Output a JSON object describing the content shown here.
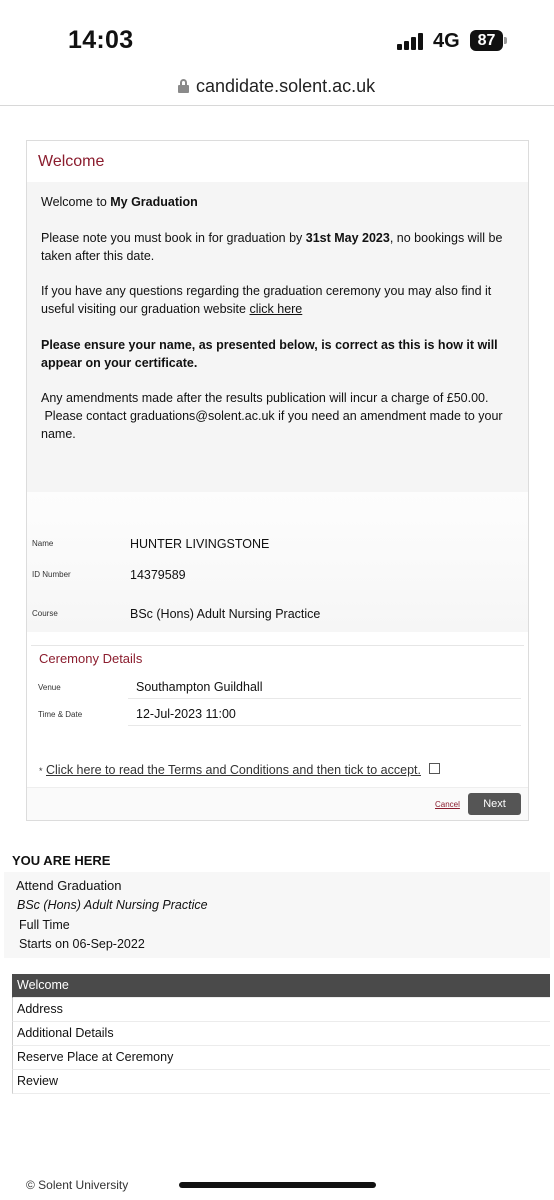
{
  "status": {
    "time": "14:03",
    "network": "4G",
    "battery": "87"
  },
  "browser": {
    "url": "candidate.solent.ac.uk"
  },
  "welcome": {
    "title": "Welcome",
    "intro_prefix": "Welcome to ",
    "intro_bold": "My Graduation",
    "note_prefix": "Please note you must book in for graduation by ",
    "note_bold": "31st May 2023",
    "note_suffix_1": ", no bookings will be",
    "note_suffix_2": "taken after this date.",
    "questions_1": "If you have any questions regarding the graduation ceremony you may also find it",
    "questions_2_prefix": "useful visiting our graduation website ",
    "questions_link": "click here",
    "ensure_1": "Please ensure your name, as presented below, is correct as this is how it will",
    "ensure_2": "appear on your certificate.",
    "amend_1": "Any amendments made after the results publication will incur a charge of £50.00.",
    "amend_2": " Please contact graduations@solent.ac.uk if you need an amendment made to your",
    "amend_3": "name."
  },
  "student": {
    "name_label": "Name",
    "name": "HUNTER LIVINGSTONE",
    "id_label": "ID Number",
    "id": "14379589",
    "course_label": "Course",
    "course": "BSc (Hons) Adult Nursing Practice"
  },
  "ceremony": {
    "title": "Ceremony Details",
    "venue_label": "Venue",
    "venue": "Southampton Guildhall",
    "datetime_label": "Time & Date",
    "datetime": "12-Jul-2023 11:00"
  },
  "terms": {
    "star": "*",
    "link": "Click here to read the Terms and Conditions and then tick to accept.",
    "checked": false
  },
  "actions": {
    "cancel": "Cancel",
    "next": "Next"
  },
  "you_are_here": {
    "heading": "YOU ARE HERE",
    "title": "Attend Graduation",
    "course": "BSc (Hons) Adult Nursing Practice",
    "mode": "Full Time",
    "starts": "Starts on 06-Sep-2022"
  },
  "steps": [
    "Welcome",
    "Address",
    "Additional Details",
    "Reserve Place at Ceremony",
    "Review"
  ],
  "footer": {
    "copyright": "© Solent University"
  }
}
